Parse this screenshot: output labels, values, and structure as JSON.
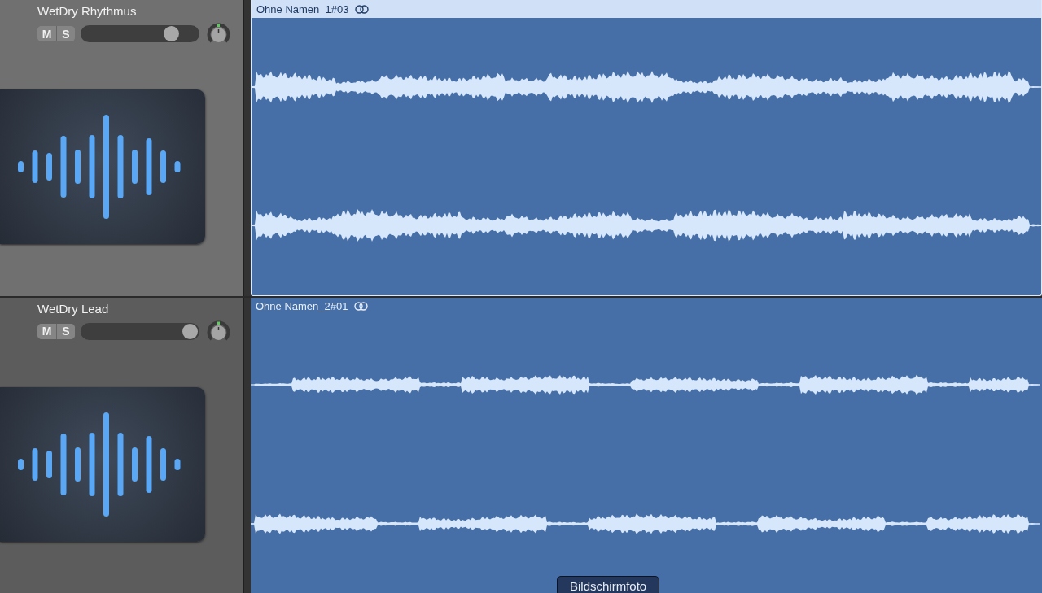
{
  "tracks": [
    {
      "name": "WetDry Rhythmus",
      "selected": true,
      "mute": "M",
      "solo": "S",
      "volume": {
        "level": 0.81
      },
      "region": {
        "title": "Ohne Namen_1#03",
        "selected": true
      }
    },
    {
      "name": "WetDry Lead",
      "selected": false,
      "mute": "M",
      "solo": "S",
      "volume": {
        "level": 0.99
      },
      "region": {
        "title": "Ohne Namen_2#01",
        "selected": false
      }
    }
  ],
  "tooltip": "Bildschirmfoto"
}
